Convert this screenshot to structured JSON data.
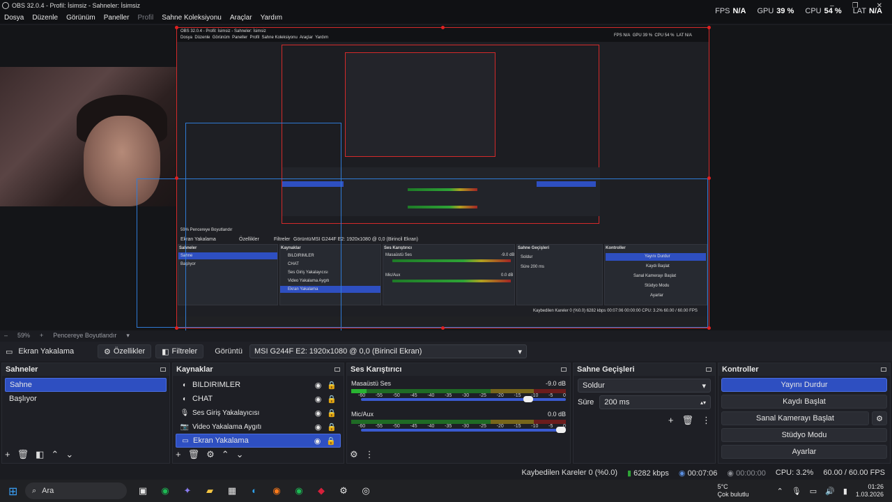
{
  "window": {
    "title": "OBS 32.0.4 - Profil: İsimsiz - Sahneler: İsimsiz",
    "controls": [
      "–",
      "❐",
      "✕"
    ]
  },
  "menu": [
    {
      "label": "Dosya",
      "disabled": false
    },
    {
      "label": "Düzenle",
      "disabled": false
    },
    {
      "label": "Görünüm",
      "disabled": false
    },
    {
      "label": "Paneller",
      "disabled": false
    },
    {
      "label": "Profil",
      "disabled": true
    },
    {
      "label": "Sahne Koleksiyonu",
      "disabled": false
    },
    {
      "label": "Araçlar",
      "disabled": false
    },
    {
      "label": "Yardım",
      "disabled": false
    }
  ],
  "stats": {
    "fps_label": "FPS",
    "fps_value": "N/A",
    "gpu_label": "GPU",
    "gpu_value": "39 %",
    "cpu_label": "CPU",
    "cpu_value": "54 %",
    "lat_label": "LAT",
    "lat_value": "N/A"
  },
  "zoom": {
    "minus": "–",
    "percent": "59%",
    "plus": "+",
    "fit_label": "Pencereye Boyutlandır"
  },
  "source_toolbar": {
    "source_name": "Ekran Yakalama",
    "properties_label": "Özellikler",
    "filters_label": "Filtreler",
    "display_label": "Görüntü",
    "display_value": "MSI G244F E2: 1920x1080 @ 0,0 (Birincil Ekran)"
  },
  "scenes": {
    "title": "Sahneler",
    "items": [
      {
        "label": "Sahne",
        "selected": true
      },
      {
        "label": "Başlıyor",
        "selected": false
      }
    ]
  },
  "sources": {
    "title": "Kaynaklar",
    "items": [
      {
        "label": "BILDIRIMLER",
        "icon": "browser-icon",
        "selected": false
      },
      {
        "label": "CHAT",
        "icon": "browser-icon",
        "selected": false
      },
      {
        "label": "Ses Giriş Yakalayıcısı",
        "icon": "microphone-icon",
        "selected": false
      },
      {
        "label": "Video Yakalama Aygıtı",
        "icon": "camera-icon",
        "selected": false
      },
      {
        "label": "Ekran Yakalama",
        "icon": "monitor-icon",
        "selected": true
      }
    ]
  },
  "mixer": {
    "title": "Ses Karıştırıcı",
    "ticks": [
      "-60",
      "-55",
      "-50",
      "-45",
      "-40",
      "-35",
      "-30",
      "-25",
      "-20",
      "-15",
      "-10",
      "-5",
      "0"
    ],
    "channels": [
      {
        "name": "Masaüstü Ses",
        "db": "-9.0 dB",
        "level": 0.07,
        "volume": 0.84
      },
      {
        "name": "Mic/Aux",
        "db": "0.0 dB",
        "level": 0.0,
        "volume": 1.0
      }
    ]
  },
  "transitions": {
    "title": "Sahne Geçişleri",
    "type": "Soldur",
    "duration_label": "Süre",
    "duration_value": "200 ms"
  },
  "controls": {
    "title": "Kontroller",
    "buttons": [
      "Yayını Durdur",
      "Kaydı Başlat",
      "Sanal Kamerayı Başlat",
      "Stüdyo Modu",
      "Ayarlar"
    ]
  },
  "status": {
    "dropped": "Kaybedilen Kareler 0 (%0.0)",
    "bitrate": "6282 kbps",
    "stream_time": "00:07:06",
    "rec_time": "00:00:00",
    "cpu": "CPU: 3.2%",
    "fps": "60.00 / 60.00 FPS"
  },
  "taskbar": {
    "search_placeholder": "Ara",
    "weather_temp": "5°C",
    "weather_desc": "Çok bulutlu",
    "time": "01:26",
    "date": "1.03.2026"
  },
  "nested_preview": {
    "title": "OBS 32.0.4 - Profil: İsimsiz - Sahneler: İsimsiz",
    "menu": [
      "Dosya",
      "Düzenle",
      "Görünüm",
      "Paneller",
      "Profil",
      "Sahne Koleksiyonu",
      "Araçlar",
      "Yardım"
    ],
    "stats": [
      "FPS N/A",
      "GPU 39 %",
      "CPU 54 %",
      "LAT N/A"
    ],
    "zoom": "59%   Pencereye Boyutlandır",
    "source_name": "Ekran Yakalama",
    "properties_label": "Özellikler",
    "filters_label": "Filtreler",
    "display_label": "Görüntü",
    "display_value": "MSI G244F E2: 1920x1080 @ 0,0 (Birincil Ekran)",
    "scenes_title": "Sahneler",
    "scenes": [
      "Sahne",
      "Başlıyor"
    ],
    "sources_title": "Kaynaklar",
    "sources": [
      "BILDIRIMLER",
      "CHAT",
      "Ses Giriş Yakalayıcısı",
      "Video Yakalama Aygıtı",
      "Ekran Yakalama"
    ],
    "mixer_title": "Ses Karıştırıcı",
    "mixer": [
      "Masaüstü Ses",
      "-9.0 dB",
      "Mic/Aux",
      "0.0 dB"
    ],
    "transitions_title": "Sahne Geçişleri",
    "transition_type": "Soldur",
    "duration": "Süre    200 ms",
    "controls_title": "Kontroller",
    "controls": [
      "Yayını Durdur",
      "Kaydı Başlat",
      "Sanal Kamerayı Başlat",
      "Stüdyo Modu",
      "Ayarlar"
    ],
    "status": "Kaybedilen Kareler 0 (%0.0)   6282 kbps   00:07:06   00:00:00   CPU: 3.2%   60.00 / 60.00 FPS"
  }
}
